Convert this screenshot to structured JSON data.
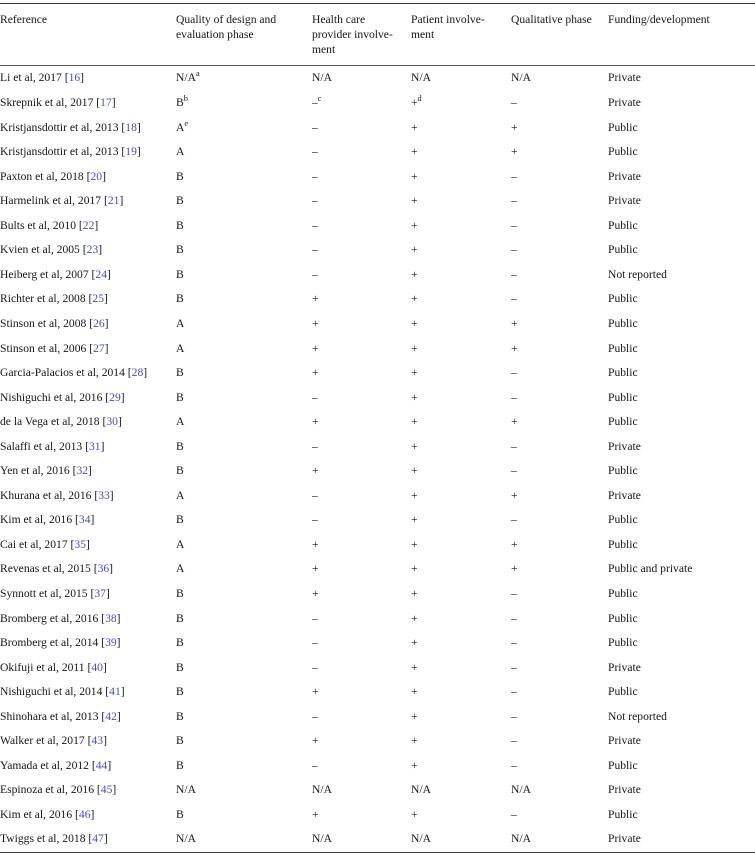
{
  "table": {
    "columns": [
      {
        "key": "reference",
        "label": "Reference"
      },
      {
        "key": "quality",
        "label": "Quality of design and evaluation phase"
      },
      {
        "key": "hcp",
        "label": "Health care provider involve-ment"
      },
      {
        "key": "patient",
        "label": "Patient involve-ment"
      },
      {
        "key": "qualitative",
        "label": "Qualitative phase"
      },
      {
        "key": "funding",
        "label": "Funding/development"
      }
    ],
    "column_labels_wrapped": {
      "reference": [
        "Reference"
      ],
      "quality": [
        "Quality of design and",
        "evaluation phase"
      ],
      "hcp": [
        "Health care",
        "provider involve-",
        "ment"
      ],
      "patient": [
        "Patient involve-",
        "ment"
      ],
      "qualitative": [
        "Qualitative phase"
      ],
      "funding": [
        "Funding/development"
      ]
    },
    "accent_reference_color": "#4a4ac8",
    "rows": [
      {
        "author": "Li et al, 2017",
        "ref": "16",
        "quality": "N/A",
        "quality_sup": "a",
        "hcp": "N/A",
        "hcp_sup": "",
        "patient": "N/A",
        "patient_sup": "",
        "qualitative": "N/A",
        "funding": "Private"
      },
      {
        "author": "Skrepnik et al, 2017",
        "ref": "17",
        "quality": "B",
        "quality_sup": "b",
        "hcp": "–",
        "hcp_sup": "c",
        "patient": "+",
        "patient_sup": "d",
        "qualitative": "–",
        "funding": "Private"
      },
      {
        "author": "Kristjansdottir et al, 2013",
        "ref": "18",
        "quality": "A",
        "quality_sup": "e",
        "hcp": "–",
        "hcp_sup": "",
        "patient": "+",
        "patient_sup": "",
        "qualitative": "+",
        "funding": "Public"
      },
      {
        "author": "Kristjansdottir et al, 2013",
        "ref": "19",
        "quality": "A",
        "quality_sup": "",
        "hcp": "–",
        "hcp_sup": "",
        "patient": "+",
        "patient_sup": "",
        "qualitative": "+",
        "funding": "Public"
      },
      {
        "author": "Paxton et al, 2018",
        "ref": "20",
        "quality": "B",
        "quality_sup": "",
        "hcp": "–",
        "hcp_sup": "",
        "patient": "+",
        "patient_sup": "",
        "qualitative": "–",
        "funding": "Private"
      },
      {
        "author": "Harmelink et al, 2017",
        "ref": "21",
        "quality": "B",
        "quality_sup": "",
        "hcp": "–",
        "hcp_sup": "",
        "patient": "+",
        "patient_sup": "",
        "qualitative": "–",
        "funding": "Private"
      },
      {
        "author": "Bults et al, 2010",
        "ref": "22",
        "quality": "B",
        "quality_sup": "",
        "hcp": "–",
        "hcp_sup": "",
        "patient": "+",
        "patient_sup": "",
        "qualitative": "–",
        "funding": "Public"
      },
      {
        "author": "Kvien et al, 2005",
        "ref": "23",
        "quality": "B",
        "quality_sup": "",
        "hcp": "–",
        "hcp_sup": "",
        "patient": "+",
        "patient_sup": "",
        "qualitative": "–",
        "funding": "Public"
      },
      {
        "author": "Heiberg et al, 2007",
        "ref": "24",
        "quality": "B",
        "quality_sup": "",
        "hcp": "–",
        "hcp_sup": "",
        "patient": "+",
        "patient_sup": "",
        "qualitative": "–",
        "funding": "Not reported"
      },
      {
        "author": "Richter et al, 2008",
        "ref": "25",
        "quality": "B",
        "quality_sup": "",
        "hcp": "+",
        "hcp_sup": "",
        "patient": "+",
        "patient_sup": "",
        "qualitative": "–",
        "funding": "Public"
      },
      {
        "author": "Stinson et al, 2008",
        "ref": "26",
        "quality": "A",
        "quality_sup": "",
        "hcp": "+",
        "hcp_sup": "",
        "patient": "+",
        "patient_sup": "",
        "qualitative": "+",
        "funding": "Public"
      },
      {
        "author": "Stinson et al, 2006",
        "ref": "27",
        "quality": "A",
        "quality_sup": "",
        "hcp": "+",
        "hcp_sup": "",
        "patient": "+",
        "patient_sup": "",
        "qualitative": "+",
        "funding": "Public"
      },
      {
        "author": "Garcia-Palacios et al, 2014",
        "ref": "28",
        "quality": "B",
        "quality_sup": "",
        "hcp": "+",
        "hcp_sup": "",
        "patient": "+",
        "patient_sup": "",
        "qualitative": "–",
        "funding": "Public"
      },
      {
        "author": "Nishiguchi et al, 2016",
        "ref": "29",
        "quality": "B",
        "quality_sup": "",
        "hcp": "–",
        "hcp_sup": "",
        "patient": "+",
        "patient_sup": "",
        "qualitative": "–",
        "funding": "Public"
      },
      {
        "author": "de la Vega et al, 2018",
        "ref": "30",
        "quality": "A",
        "quality_sup": "",
        "hcp": "+",
        "hcp_sup": "",
        "patient": "+",
        "patient_sup": "",
        "qualitative": "+",
        "funding": "Public"
      },
      {
        "author": "Salaffi et al, 2013",
        "ref": "31",
        "quality": "B",
        "quality_sup": "",
        "hcp": "–",
        "hcp_sup": "",
        "patient": "+",
        "patient_sup": "",
        "qualitative": "–",
        "funding": "Private"
      },
      {
        "author": "Yen et al, 2016",
        "ref": "32",
        "quality": "B",
        "quality_sup": "",
        "hcp": "+",
        "hcp_sup": "",
        "patient": "+",
        "patient_sup": "",
        "qualitative": "–",
        "funding": "Public"
      },
      {
        "author": "Khurana et al, 2016",
        "ref": "33",
        "quality": "A",
        "quality_sup": "",
        "hcp": "–",
        "hcp_sup": "",
        "patient": "+",
        "patient_sup": "",
        "qualitative": "+",
        "funding": "Private"
      },
      {
        "author": "Kim et al, 2016",
        "ref": "34",
        "quality": "B",
        "quality_sup": "",
        "hcp": "–",
        "hcp_sup": "",
        "patient": "+",
        "patient_sup": "",
        "qualitative": "–",
        "funding": "Public"
      },
      {
        "author": "Cai et al, 2017",
        "ref": "35",
        "quality": "A",
        "quality_sup": "",
        "hcp": "+",
        "hcp_sup": "",
        "patient": "+",
        "patient_sup": "",
        "qualitative": "+",
        "funding": "Public"
      },
      {
        "author": "Revenas et al, 2015",
        "ref": "36",
        "quality": "A",
        "quality_sup": "",
        "hcp": "+",
        "hcp_sup": "",
        "patient": "+",
        "patient_sup": "",
        "qualitative": "+",
        "funding": "Public and private"
      },
      {
        "author": "Synnott et al, 2015",
        "ref": "37",
        "quality": "B",
        "quality_sup": "",
        "hcp": "+",
        "hcp_sup": "",
        "patient": "+",
        "patient_sup": "",
        "qualitative": "–",
        "funding": "Public"
      },
      {
        "author": "Bromberg et al, 2016",
        "ref": "38",
        "quality": "B",
        "quality_sup": "",
        "hcp": "–",
        "hcp_sup": "",
        "patient": "+",
        "patient_sup": "",
        "qualitative": "–",
        "funding": "Public"
      },
      {
        "author": "Bromberg et al, 2014",
        "ref": "39",
        "quality": "B",
        "quality_sup": "",
        "hcp": "–",
        "hcp_sup": "",
        "patient": "+",
        "patient_sup": "",
        "qualitative": "–",
        "funding": "Public"
      },
      {
        "author": "Okifuji et al, 2011",
        "ref": "40",
        "quality": "B",
        "quality_sup": "",
        "hcp": "–",
        "hcp_sup": "",
        "patient": "+",
        "patient_sup": "",
        "qualitative": "–",
        "funding": "Private"
      },
      {
        "author": "Nishiguchi et al, 2014",
        "ref": "41",
        "quality": "B",
        "quality_sup": "",
        "hcp": "+",
        "hcp_sup": "",
        "patient": "+",
        "patient_sup": "",
        "qualitative": "–",
        "funding": "Public"
      },
      {
        "author": "Shinohara et al, 2013",
        "ref": "42",
        "quality": "B",
        "quality_sup": "",
        "hcp": "–",
        "hcp_sup": "",
        "patient": "+",
        "patient_sup": "",
        "qualitative": "–",
        "funding": "Not reported"
      },
      {
        "author": "Walker et al, 2017",
        "ref": "43",
        "quality": "B",
        "quality_sup": "",
        "hcp": "+",
        "hcp_sup": "",
        "patient": "+",
        "patient_sup": "",
        "qualitative": "–",
        "funding": "Private"
      },
      {
        "author": "Yamada et al, 2012",
        "ref": "44",
        "quality": "B",
        "quality_sup": "",
        "hcp": "–",
        "hcp_sup": "",
        "patient": "+",
        "patient_sup": "",
        "qualitative": "–",
        "funding": "Public"
      },
      {
        "author": "Espinoza et al, 2016",
        "ref": "45",
        "quality": "N/A",
        "quality_sup": "",
        "hcp": "N/A",
        "hcp_sup": "",
        "patient": "N/A",
        "patient_sup": "",
        "qualitative": "N/A",
        "funding": "Private"
      },
      {
        "author": "Kim et al, 2016",
        "ref": "46",
        "quality": "B",
        "quality_sup": "",
        "hcp": "+",
        "hcp_sup": "",
        "patient": "+",
        "patient_sup": "",
        "qualitative": "–",
        "funding": "Public"
      },
      {
        "author": "Twiggs et al, 2018",
        "ref": "47",
        "quality": "N/A",
        "quality_sup": "",
        "hcp": "N/A",
        "hcp_sup": "",
        "patient": "N/A",
        "patient_sup": "",
        "qualitative": "N/A",
        "funding": "Private"
      }
    ]
  }
}
